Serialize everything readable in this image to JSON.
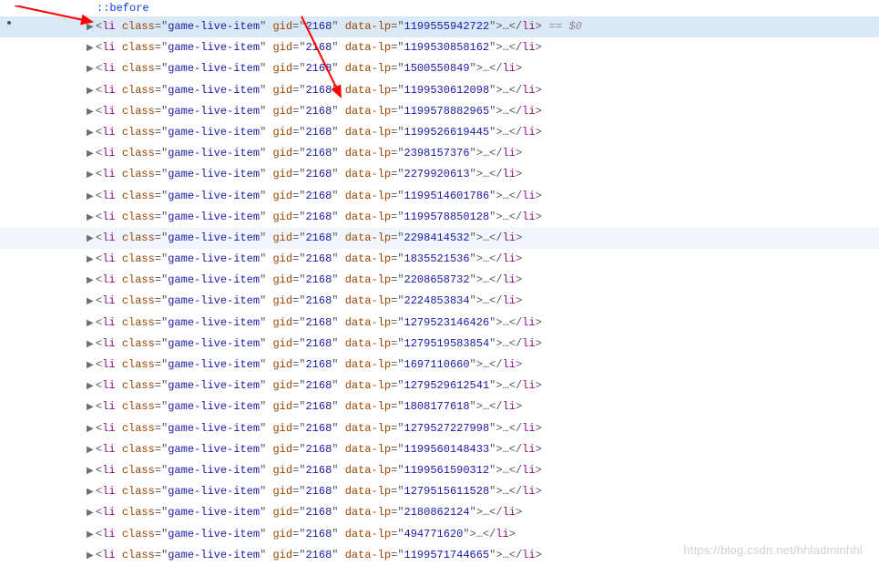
{
  "pseudo": "::before",
  "eq_marker": "== $0",
  "tag": "li",
  "class_attr_name": "class",
  "class_attr_value": "game-live-item",
  "gid_attr_name": "gid",
  "gid_attr_value": "2168",
  "datalp_attr_name": "data-lp",
  "ellipsis": "…",
  "close_tag": "li",
  "watermark": "https://blog.csdn.net/hhladminhhl",
  "rows": [
    {
      "lp": "1199555942722",
      "highlight": true,
      "faded": false,
      "eq": true,
      "dot": true
    },
    {
      "lp": "1199530858162",
      "highlight": false,
      "faded": false,
      "eq": false,
      "dot": false
    },
    {
      "lp": "1500550849",
      "highlight": false,
      "faded": false,
      "eq": false,
      "dot": false
    },
    {
      "lp": "1199530612098",
      "highlight": false,
      "faded": false,
      "eq": false,
      "dot": false
    },
    {
      "lp": "1199578882965",
      "highlight": false,
      "faded": false,
      "eq": false,
      "dot": false
    },
    {
      "lp": "1199526619445",
      "highlight": false,
      "faded": false,
      "eq": false,
      "dot": false
    },
    {
      "lp": "2398157376",
      "highlight": false,
      "faded": false,
      "eq": false,
      "dot": false
    },
    {
      "lp": "2279920613",
      "highlight": false,
      "faded": false,
      "eq": false,
      "dot": false
    },
    {
      "lp": "1199514601786",
      "highlight": false,
      "faded": false,
      "eq": false,
      "dot": false
    },
    {
      "lp": "1199578850128",
      "highlight": false,
      "faded": false,
      "eq": false,
      "dot": false
    },
    {
      "lp": "2298414532",
      "highlight": false,
      "faded": true,
      "eq": false,
      "dot": false
    },
    {
      "lp": "1835521536",
      "highlight": false,
      "faded": false,
      "eq": false,
      "dot": false
    },
    {
      "lp": "2208658732",
      "highlight": false,
      "faded": false,
      "eq": false,
      "dot": false
    },
    {
      "lp": "2224853834",
      "highlight": false,
      "faded": false,
      "eq": false,
      "dot": false
    },
    {
      "lp": "1279523146426",
      "highlight": false,
      "faded": false,
      "eq": false,
      "dot": false
    },
    {
      "lp": "1279519583854",
      "highlight": false,
      "faded": false,
      "eq": false,
      "dot": false
    },
    {
      "lp": "1697110660",
      "highlight": false,
      "faded": false,
      "eq": false,
      "dot": false
    },
    {
      "lp": "1279529612541",
      "highlight": false,
      "faded": false,
      "eq": false,
      "dot": false
    },
    {
      "lp": "1808177618",
      "highlight": false,
      "faded": false,
      "eq": false,
      "dot": false
    },
    {
      "lp": "1279527227998",
      "highlight": false,
      "faded": false,
      "eq": false,
      "dot": false
    },
    {
      "lp": "1199560148433",
      "highlight": false,
      "faded": false,
      "eq": false,
      "dot": false
    },
    {
      "lp": "1199561590312",
      "highlight": false,
      "faded": false,
      "eq": false,
      "dot": false
    },
    {
      "lp": "1279515611528",
      "highlight": false,
      "faded": false,
      "eq": false,
      "dot": false
    },
    {
      "lp": "2180862124",
      "highlight": false,
      "faded": false,
      "eq": false,
      "dot": false
    },
    {
      "lp": "494771620",
      "highlight": false,
      "faded": false,
      "eq": false,
      "dot": false
    },
    {
      "lp": "1199571744665",
      "highlight": false,
      "faded": false,
      "eq": false,
      "dot": false
    }
  ]
}
